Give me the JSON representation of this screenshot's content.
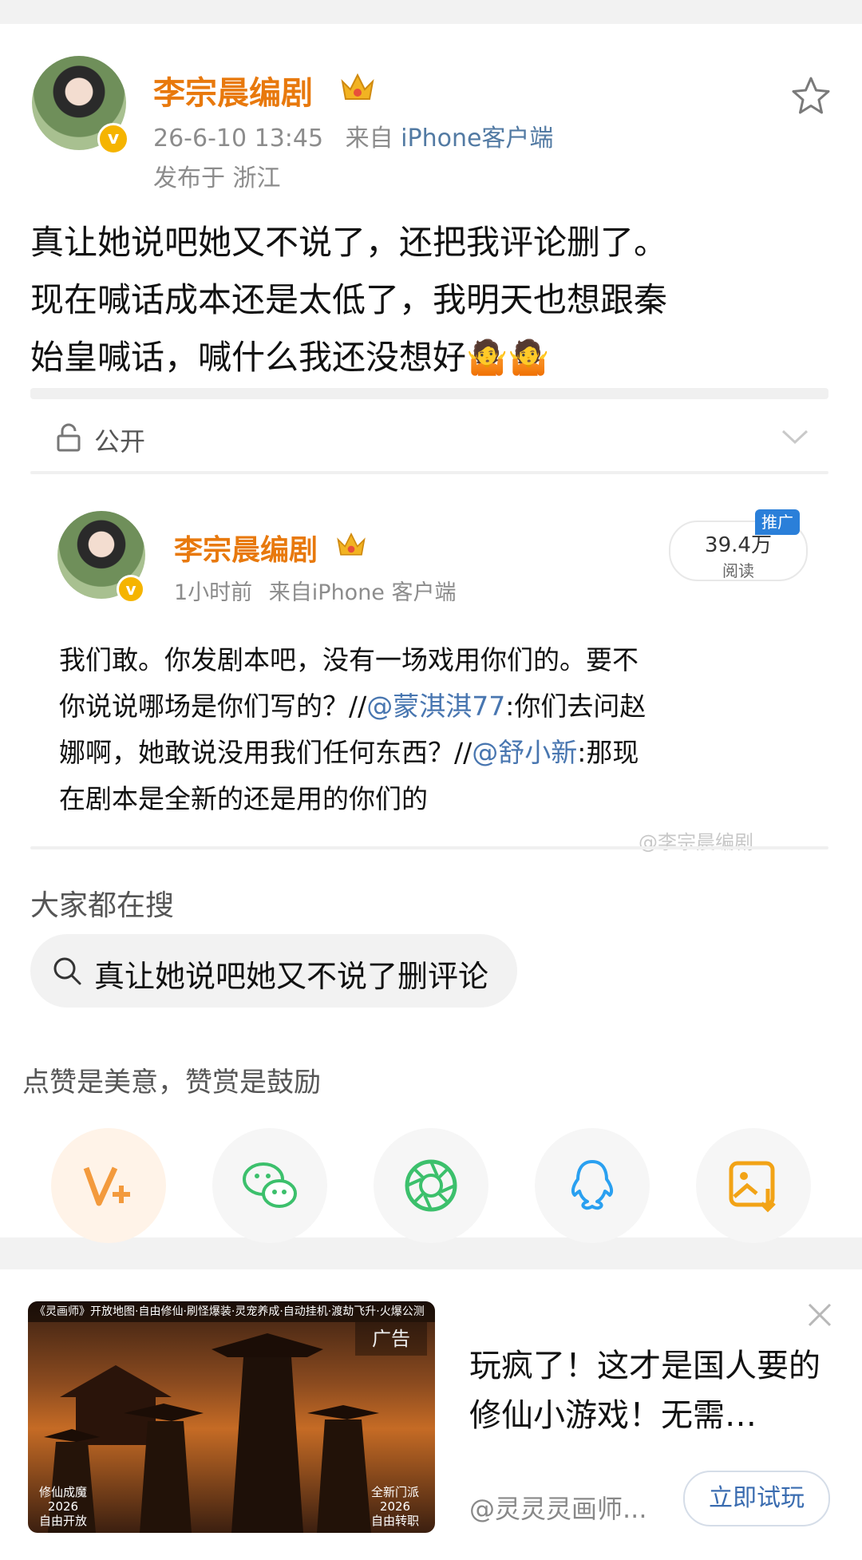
{
  "post": {
    "author": "李宗晨编剧",
    "time": "26-6-10 13:45",
    "source_prefix": "来自",
    "source": "iPhone客户端",
    "location": "发布于 浙江",
    "text_line1": "真让她说吧她又不说了，还把我评论删了。",
    "text_line2": "现在喊话成本还是太低了，我明天也想跟秦",
    "text_line3": "始皇喊话，喊什么我还没想好🤷🤷",
    "visibility": "公开"
  },
  "repost": {
    "author": "李宗晨编剧",
    "time": "1小时前",
    "source": "来自iPhone 客户端",
    "views": "39.4万",
    "views_label": "阅读",
    "promo_tag": "推广",
    "line1": "我们敢。你发剧本吧，没有一场戏用你们的。要不",
    "line2a": "你说说哪场是你们写的？//",
    "mention1": "@蒙淇淇77",
    "line2b": ":你们去问赵",
    "line3a": "娜啊，她敢说没用我们任何东西？//",
    "mention2": "@舒小新",
    "line3b": ":那现",
    "line4": "在剧本是全新的还是用的你们的",
    "watermark": "@李宗晨编剧"
  },
  "search": {
    "title": "大家都在搜",
    "query": "真让她说吧她又不说了删评论"
  },
  "reward": {
    "text": "点赞是美意，赞赏是鼓励"
  },
  "share": {
    "icons": [
      "reward-v-plus-icon",
      "wechat-icon",
      "moments-icon",
      "qq-icon",
      "save-image-icon"
    ],
    "colors": {
      "reward": "#f39a3d",
      "wechat": "#3cc06c",
      "moments": "#3cc06c",
      "qq": "#2aa0f0",
      "save": "#f2a316"
    }
  },
  "ad": {
    "banner": "《灵画师》开放地图·自由修仙·刷怪爆装·灵宠养成·自动挂机·渡劫飞升·火爆公测",
    "tag": "广告",
    "corner_left": "修仙成魔\n2026\n自由开放",
    "corner_right": "全新门派\n2026\n自由转职",
    "title": "玩疯了！这才是国人要的修仙小游戏！无需…",
    "source": "@灵灵灵画师...",
    "cta": "立即试玩"
  }
}
